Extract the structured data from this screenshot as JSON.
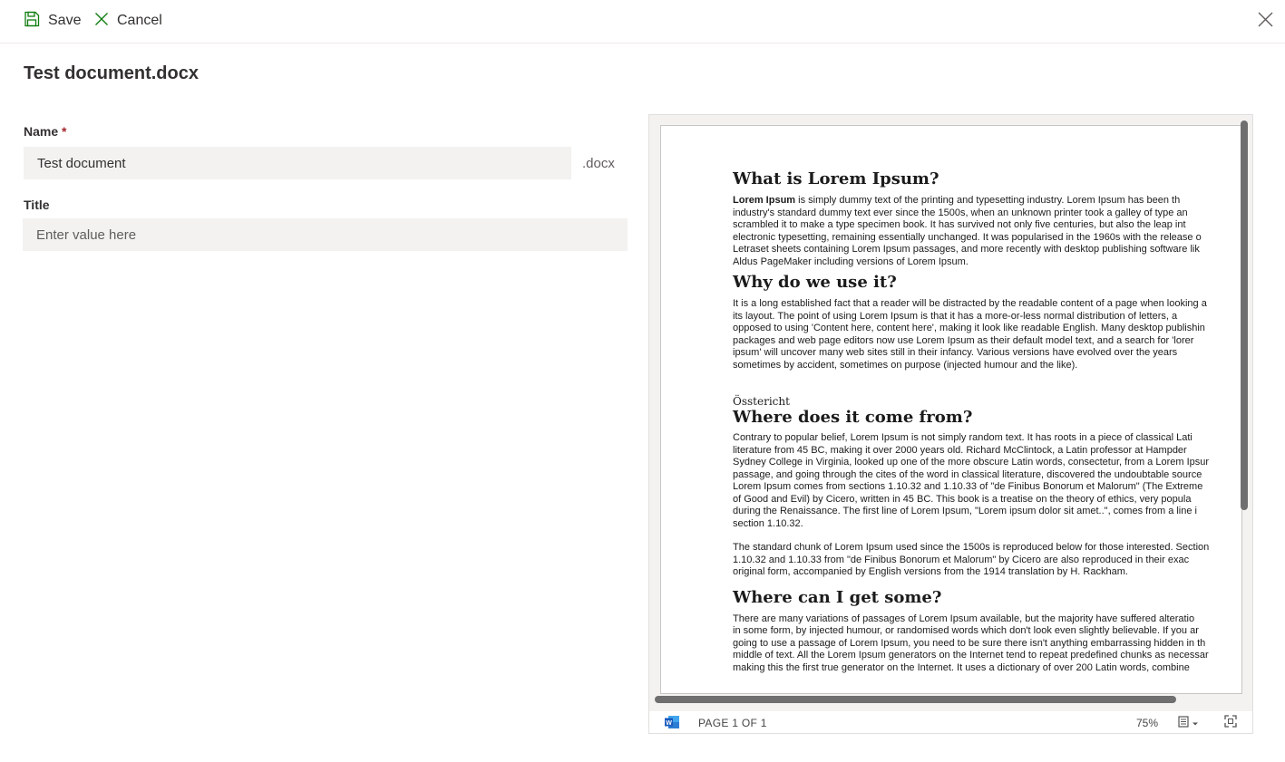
{
  "toolbar": {
    "save_label": "Save",
    "cancel_label": "Cancel"
  },
  "document_title": "Test document.docx",
  "form": {
    "name_label": "Name",
    "required_mark": "*",
    "name_value": "Test document",
    "extension": ".docx",
    "title_label": "Title",
    "title_placeholder": "Enter value here"
  },
  "preview": {
    "page_indicator": "PAGE 1 OF 1",
    "zoom": "75%",
    "content": {
      "h1": "What is Lorem Ipsum?",
      "p1_bold": "Lorem Ipsum",
      "p1_lines": [
        " is simply dummy text of the printing and typesetting industry. Lorem Ipsum has been th",
        "industry's standard dummy text ever since the 1500s, when an unknown printer took a galley of type an",
        "scrambled it to make a type specimen book. It has survived not only five centuries, but also the leap int",
        "electronic typesetting, remaining essentially unchanged. It was popularised in the 1960s with the release o",
        "Letraset sheets containing Lorem Ipsum passages, and more recently with desktop publishing software lik",
        "Aldus PageMaker including versions of Lorem Ipsum."
      ],
      "h2": "Why do we use it?",
      "p2_lines": [
        "It is a long established fact that a reader will be distracted by the readable content of a page when looking a",
        "its layout. The point of using Lorem Ipsum is that it has a more-or-less normal distribution of letters, a",
        "opposed to using 'Content here, content here', making it look like readable English. Many desktop publishin",
        "packages and web page editors now use Lorem Ipsum as their default model text, and a search for 'lorer",
        "ipsum' will uncover many web sites still in their infancy. Various versions have evolved over the years",
        "sometimes by accident, sometimes on purpose (injected humour and the like)."
      ],
      "small": "Össtericht",
      "h3": "Where does it come from?",
      "p3_lines": [
        "Contrary to popular belief, Lorem Ipsum is not simply random text. It has roots in a piece of classical Lati",
        "literature from 45 BC, making it over 2000 years old. Richard McClintock, a Latin professor at Hampder",
        "Sydney College in Virginia, looked up one of the more obscure Latin words, consectetur, from a Lorem Ipsur",
        "passage, and going through the cites of the word in classical literature, discovered the undoubtable source",
        "Lorem Ipsum comes from sections 1.10.32 and 1.10.33 of \"de Finibus Bonorum et Malorum\" (The Extreme",
        "of Good and Evil) by Cicero, written in 45 BC. This book is a treatise on the theory of ethics, very popula",
        "during the Renaissance. The first line of Lorem Ipsum, \"Lorem ipsum dolor sit amet..\", comes from a line i",
        "section 1.10.32."
      ],
      "p4_lines": [
        "The standard chunk of Lorem Ipsum used since the 1500s is reproduced below for those interested. Section",
        "1.10.32 and 1.10.33 from \"de Finibus Bonorum et Malorum\" by Cicero are also reproduced in their exac",
        "original form, accompanied by English versions from the 1914 translation by H. Rackham."
      ],
      "h4": "Where can I get some?",
      "p5_lines": [
        "There are many variations of passages of Lorem Ipsum available, but the majority have suffered alteratio",
        "in some form, by injected humour, or randomised words which don't look even slightly believable. If you ar",
        "going to use a passage of Lorem Ipsum, you need to be sure there isn't anything embarrassing hidden in th",
        "middle of text. All the Lorem Ipsum generators on the Internet tend to repeat predefined chunks as necessar",
        "making this the first true generator on the Internet. It uses a dictionary of over 200 Latin words, combine"
      ]
    }
  },
  "colors": {
    "accent": "#107c10",
    "required": "#a4262c",
    "field_bg": "#f3f2f1",
    "word_blue": "#185abd"
  },
  "icons": {
    "save": "save-icon",
    "cancel": "cancel-icon",
    "close": "close-icon",
    "word": "word-icon",
    "view_mode": "reading-view-icon",
    "fullscreen": "fullscreen-icon"
  }
}
